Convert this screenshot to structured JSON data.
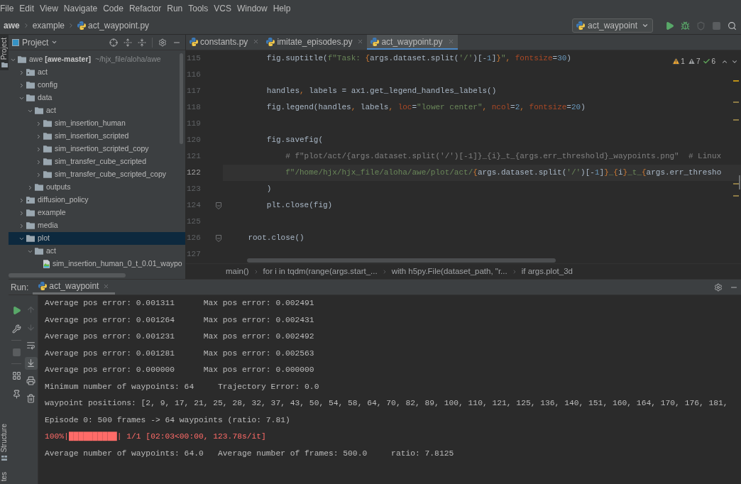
{
  "menu_bar": [
    "File",
    "Edit",
    "View",
    "Navigate",
    "Code",
    "Refactor",
    "Run",
    "Tools",
    "VCS",
    "Window",
    "Help"
  ],
  "navigation_bar": {
    "breadcrumbs": [
      {
        "kind": "project",
        "label": "awe"
      },
      {
        "kind": "folder",
        "label": "example"
      },
      {
        "kind": "file",
        "label": "act_waypoint.py"
      }
    ],
    "run_configuration": "act_waypoint",
    "actions": [
      {
        "kind": "run",
        "disabled": false
      },
      {
        "kind": "debug",
        "disabled": false
      },
      {
        "kind": "coverage",
        "disabled": true
      },
      {
        "kind": "stop",
        "disabled": true
      },
      {
        "kind": "search",
        "disabled": false
      }
    ]
  },
  "left_stripe": {
    "top_tabs": [
      {
        "kind": "project",
        "label": "Project",
        "selected": true
      }
    ],
    "bottom_tabs": [
      {
        "kind": "structure",
        "label": "Structure",
        "selected": false
      },
      {
        "kind": "plain",
        "label": "tes",
        "selected": false
      }
    ]
  },
  "project_panel": {
    "title": "Project",
    "tree": [
      {
        "kind": "folder",
        "name": "awe",
        "module": "[awe-master]",
        "path": "~/hjx_file/aloha/awe",
        "expanded": true,
        "selected": false,
        "children": [
          {
            "kind": "package",
            "name": "act",
            "expanded": false,
            "selected": false
          },
          {
            "kind": "folder",
            "name": "config",
            "expanded": false,
            "selected": false
          },
          {
            "kind": "folder",
            "name": "data",
            "expanded": true,
            "selected": false,
            "children": [
              {
                "kind": "folder",
                "name": "act",
                "expanded": true,
                "selected": false,
                "children": [
                  {
                    "kind": "folder",
                    "name": "sim_insertion_human",
                    "expanded": false,
                    "selected": false
                  },
                  {
                    "kind": "folder",
                    "name": "sim_insertion_scripted",
                    "expanded": false,
                    "selected": false
                  },
                  {
                    "kind": "folder",
                    "name": "sim_insertion_scripted_copy",
                    "expanded": false,
                    "selected": false
                  },
                  {
                    "kind": "folder",
                    "name": "sim_transfer_cube_scripted",
                    "expanded": false,
                    "selected": false
                  },
                  {
                    "kind": "folder",
                    "name": "sim_transfer_cube_scripted_copy",
                    "expanded": false,
                    "selected": false
                  }
                ]
              },
              {
                "kind": "folder",
                "name": "outputs",
                "expanded": false,
                "selected": false
              }
            ]
          },
          {
            "kind": "package",
            "name": "diffusion_policy",
            "expanded": false,
            "selected": false
          },
          {
            "kind": "folder",
            "name": "example",
            "expanded": false,
            "selected": false
          },
          {
            "kind": "folder",
            "name": "media",
            "expanded": false,
            "selected": false
          },
          {
            "kind": "folder",
            "name": "plot",
            "expanded": true,
            "selected": true,
            "children": [
              {
                "kind": "folder",
                "name": "act",
                "expanded": true,
                "selected": false,
                "children": [
                  {
                    "kind": "image_file",
                    "name": "sim_insertion_human_0_t_0.01_waypo",
                    "selected": false
                  }
                ]
              }
            ]
          }
        ]
      }
    ]
  },
  "editor": {
    "tabs": [
      {
        "label": "constants.py",
        "selected": false
      },
      {
        "label": "imitate_episodes.py",
        "selected": false
      },
      {
        "label": "act_waypoint.py",
        "selected": true
      }
    ],
    "inspections": [
      {
        "kind": "warning",
        "count": "1"
      },
      {
        "kind": "weak_warning",
        "count": "7"
      },
      {
        "kind": "typo",
        "count": "6"
      }
    ],
    "lines": [
      {
        "number": "115",
        "current": false,
        "fold": false,
        "tokens": [
          {
            "kind": "plain",
            "text": "        fig.suptitle("
          },
          {
            "kind": "string",
            "text": "f\"Task: "
          },
          {
            "kind": "brace",
            "text": "{"
          },
          {
            "kind": "plain",
            "text": "args.dataset.split("
          },
          {
            "kind": "string",
            "text": "'/'"
          },
          {
            "kind": "plain",
            "text": ")[-"
          },
          {
            "kind": "number",
            "text": "1"
          },
          {
            "kind": "plain",
            "text": "]"
          },
          {
            "kind": "brace",
            "text": "}"
          },
          {
            "kind": "string",
            "text": "\""
          },
          {
            "kind": "punct",
            "text": ", "
          },
          {
            "kind": "keyword_arg",
            "text": "fontsize"
          },
          {
            "kind": "plain",
            "text": "="
          },
          {
            "kind": "number",
            "text": "30"
          },
          {
            "kind": "plain",
            "text": ")"
          }
        ]
      },
      {
        "number": "116",
        "current": false,
        "fold": false
      },
      {
        "number": "117",
        "current": false,
        "fold": false,
        "tokens": [
          {
            "kind": "plain",
            "text": "        handles"
          },
          {
            "kind": "punct",
            "text": ", "
          },
          {
            "kind": "plain",
            "text": "labels = ax1.get_legend_handles_labels()"
          }
        ]
      },
      {
        "number": "118",
        "current": false,
        "fold": false,
        "tokens": [
          {
            "kind": "plain",
            "text": "        fig.legend(handles"
          },
          {
            "kind": "punct",
            "text": ", "
          },
          {
            "kind": "plain",
            "text": "labels"
          },
          {
            "kind": "punct",
            "text": ", "
          },
          {
            "kind": "keyword_arg",
            "text": "loc"
          },
          {
            "kind": "plain",
            "text": "="
          },
          {
            "kind": "string",
            "text": "\"lower center\""
          },
          {
            "kind": "punct",
            "text": ", "
          },
          {
            "kind": "keyword_arg",
            "text": "ncol"
          },
          {
            "kind": "plain",
            "text": "="
          },
          {
            "kind": "number",
            "text": "2"
          },
          {
            "kind": "punct",
            "text": ", "
          },
          {
            "kind": "keyword_arg",
            "text": "fontsize"
          },
          {
            "kind": "plain",
            "text": "="
          },
          {
            "kind": "number",
            "text": "20"
          },
          {
            "kind": "plain",
            "text": ")"
          }
        ]
      },
      {
        "number": "119",
        "current": false,
        "fold": false
      },
      {
        "number": "120",
        "current": false,
        "fold": false,
        "tokens": [
          {
            "kind": "plain",
            "text": "        fig.savefig("
          }
        ]
      },
      {
        "number": "121",
        "current": false,
        "fold": false,
        "tokens": [
          {
            "kind": "comment",
            "text": "            # f\"plot/act/{args.dataset.split('/')[-1]}_{i}_t_{args.err_threshold}_waypoints.png\"  # Linux"
          }
        ]
      },
      {
        "number": "122",
        "current": true,
        "fold": false,
        "tokens": [
          {
            "kind": "string",
            "text": "            f\"/home/hjx/hjx_file/aloha/awe/plot/act/"
          },
          {
            "kind": "brace",
            "text": "{"
          },
          {
            "kind": "plain",
            "text": "args.dataset.split("
          },
          {
            "kind": "string",
            "text": "'/'"
          },
          {
            "kind": "plain",
            "text": ")[-"
          },
          {
            "kind": "number",
            "text": "1"
          },
          {
            "kind": "plain",
            "text": "]"
          },
          {
            "kind": "brace",
            "text": "}"
          },
          {
            "kind": "string",
            "text": "_"
          },
          {
            "kind": "brace",
            "text": "{"
          },
          {
            "kind": "plain",
            "text": "i"
          },
          {
            "kind": "brace",
            "text": "}"
          },
          {
            "kind": "string",
            "text": "_t_"
          },
          {
            "kind": "brace",
            "text": "{"
          },
          {
            "kind": "plain",
            "text": "args.err_thresho"
          }
        ]
      },
      {
        "number": "123",
        "current": false,
        "fold": false,
        "tokens": [
          {
            "kind": "plain",
            "text": "        )"
          }
        ]
      },
      {
        "number": "124",
        "current": false,
        "fold": true,
        "tokens": [
          {
            "kind": "plain",
            "text": "        plt.close(fig)"
          }
        ]
      },
      {
        "number": "125",
        "current": false,
        "fold": false
      },
      {
        "number": "126",
        "current": false,
        "fold": true,
        "tokens": [
          {
            "kind": "plain",
            "text": "    root.close()"
          }
        ]
      },
      {
        "number": "127",
        "current": false,
        "fold": false
      }
    ],
    "breadcrumbs": [
      "main()",
      "for i in tqdm(range(args.start_...",
      "with h5py.File(dataset_path, \"r...",
      "if args.plot_3d"
    ]
  },
  "run_panel": {
    "label": "Run:",
    "tabs": [
      {
        "label": "act_waypoint",
        "selected": true
      }
    ],
    "tools_left": [
      {
        "kind": "rerun",
        "disabled": false,
        "on": false
      },
      {
        "kind": "wrench",
        "disabled": false,
        "on": false
      },
      {
        "kind": "separator"
      },
      {
        "kind": "stop",
        "disabled": true,
        "on": false
      },
      {
        "kind": "separator"
      },
      {
        "kind": "layout",
        "disabled": false,
        "on": false
      },
      {
        "kind": "pin",
        "disabled": false,
        "on": false
      }
    ],
    "tools_right": [
      {
        "kind": "up",
        "disabled": true,
        "on": false
      },
      {
        "kind": "down",
        "disabled": true,
        "on": false
      },
      {
        "kind": "soft_wrap",
        "disabled": false,
        "on": false
      },
      {
        "kind": "scroll_to_end",
        "disabled": false,
        "on": true
      },
      {
        "kind": "print",
        "disabled": false,
        "on": false
      },
      {
        "kind": "delete",
        "disabled": false,
        "on": false
      }
    ],
    "console": [
      {
        "kind": "stdout",
        "text": "Average pos error: 0.001311      Max pos error: 0.002491"
      },
      {
        "kind": "stdout",
        "text": "Average pos error: 0.001264      Max pos error: 0.002431"
      },
      {
        "kind": "stdout",
        "text": "Average pos error: 0.001231      Max pos error: 0.002492"
      },
      {
        "kind": "stdout",
        "text": "Average pos error: 0.001281      Max pos error: 0.002563"
      },
      {
        "kind": "stdout",
        "text": "Average pos error: 0.000000      Max pos error: 0.000000"
      },
      {
        "kind": "stdout",
        "text": "Minimum number of waypoints: 64     Trajectory Error: 0.0"
      },
      {
        "kind": "stdout",
        "text": "waypoint positions: [2, 9, 17, 21, 25, 28, 32, 37, 43, 50, 54, 58, 64, 70, 82, 89, 100, 110, 121, 125, 136, 140, 151, 160, 164, 170, 176, 181,"
      },
      {
        "kind": "stdout",
        "text": "Episode 0: 500 frames -> 64 waypoints (ratio: 7.81)"
      },
      {
        "kind": "stderr",
        "text": "100%|██████████| 1/1 [02:03<00:00, 123.78s/it]"
      },
      {
        "kind": "stdout",
        "text": "Average number of waypoints: 64.0   Average number of frames: 500.0     ratio: 7.8125"
      }
    ]
  }
}
